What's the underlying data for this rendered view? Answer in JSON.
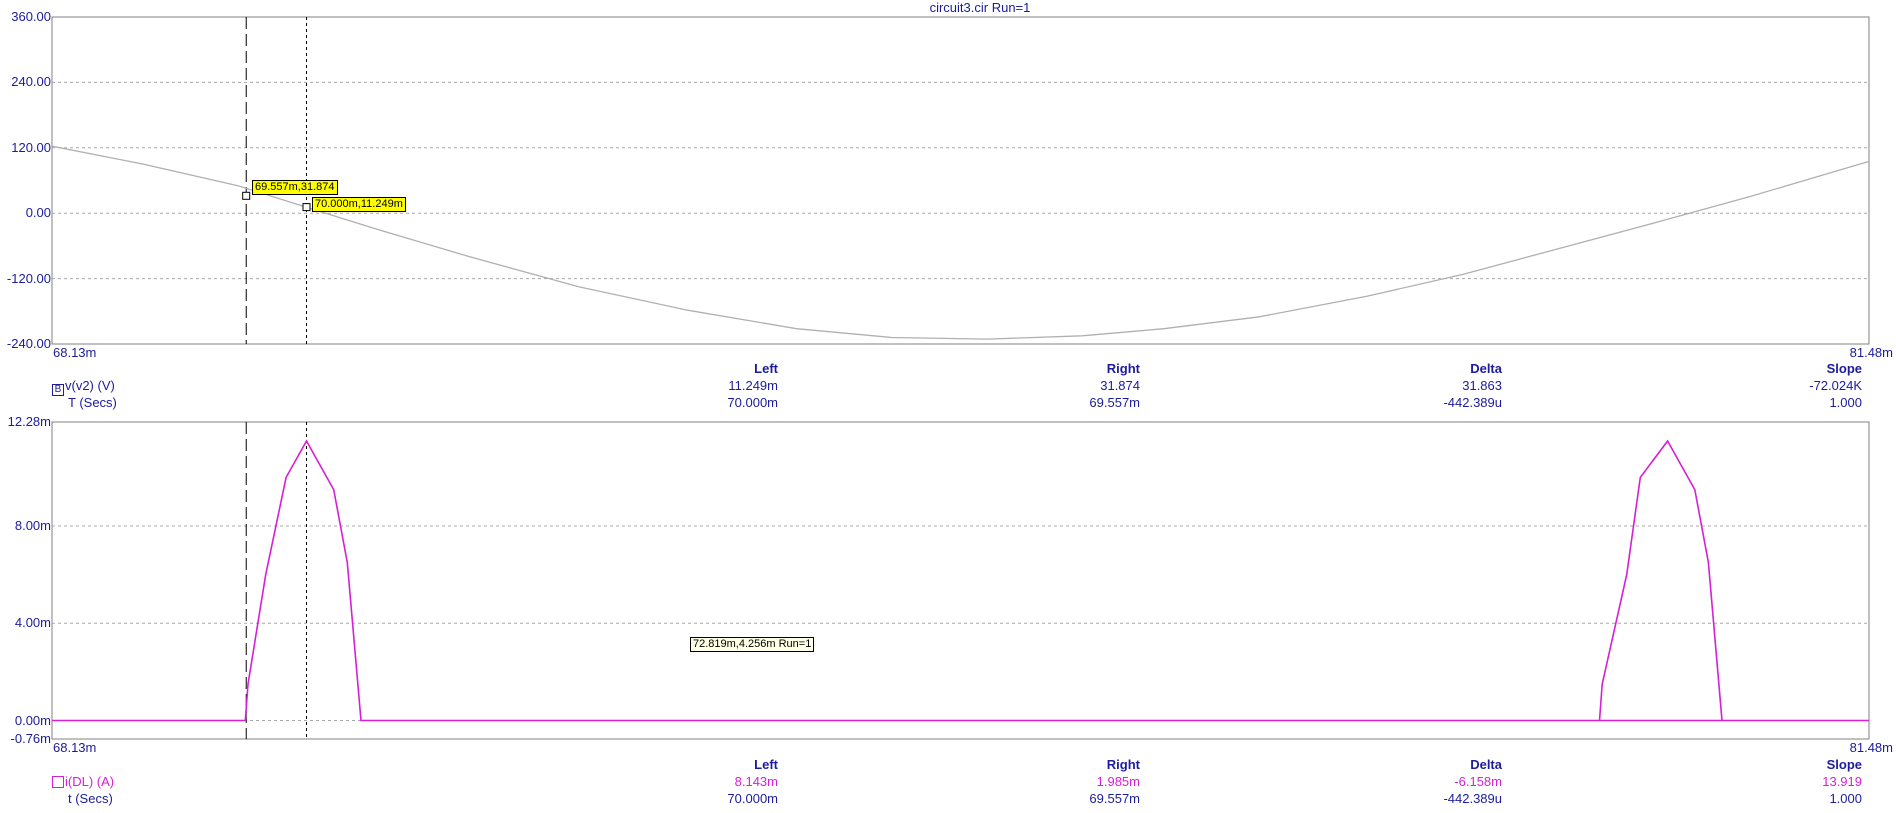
{
  "title": "circuit3.cir Run=1",
  "colors": {
    "axis_text": "#1c1c9c",
    "series_top": "#b0b0b0",
    "series_bottom": "#d61fd6",
    "grid": "#a8a8a8",
    "cursor_tag": "#ffff00"
  },
  "chart_data": [
    {
      "type": "line",
      "name": "top-panel",
      "y_tick_labels": [
        "360.00",
        "240.00",
        "120.00",
        "0.00",
        "-120.00",
        "-240.00"
      ],
      "y_ticks": [
        360,
        240,
        120,
        0,
        -120,
        -240
      ],
      "ylim": [
        -240,
        360
      ],
      "x_min_label": "68.13m",
      "x_max_label": "81.48m",
      "xlim": [
        68.13,
        81.48
      ],
      "x_unit": "ms",
      "series": [
        {
          "name": "v(v2) (V)",
          "x": [
            68.13,
            68.8,
            69.5,
            70.0,
            70.5,
            71.2,
            72.0,
            72.8,
            73.6,
            74.3,
            75.0,
            75.7,
            76.3,
            77.0,
            77.8,
            78.5,
            79.2,
            79.9,
            80.6,
            81.48
          ],
          "y": [
            123,
            90,
            50,
            11,
            -28,
            -80,
            -135,
            -178,
            -212,
            -228,
            -231,
            -225,
            -212,
            -190,
            -152,
            -112,
            -65,
            -18,
            30,
            95
          ]
        }
      ],
      "cursor_tags": [
        "69.557m,31.874",
        "70.000m,11.249m"
      ],
      "cursors": [
        {
          "x": 69.557,
          "y": 31.874,
          "style": "dashed"
        },
        {
          "x": 70.0,
          "y": 11.249,
          "style": "dotted"
        }
      ],
      "readout": {
        "headers": [
          "Left",
          "Right",
          "Delta",
          "Slope"
        ],
        "series_label": "v(v2) (V)",
        "series_icon": "B",
        "x_label": "T (Secs)",
        "series_values": [
          "11.249m",
          "31.874",
          "31.863",
          "-72.024K"
        ],
        "x_values": [
          "70.000m",
          "69.557m",
          "-442.389u",
          "1.000"
        ]
      }
    },
    {
      "type": "line",
      "name": "bottom-panel",
      "y_tick_labels": [
        "12.28m",
        "8.00m",
        "4.00m",
        "0.00m",
        "-0.76m"
      ],
      "y_ticks": [
        12.28,
        8.0,
        4.0,
        0.0,
        -0.76
      ],
      "ylim": [
        -0.76,
        12.28
      ],
      "x_min_label": "68.13m",
      "x_max_label": "81.48m",
      "xlim": [
        68.13,
        81.48
      ],
      "x_unit": "ms",
      "series": [
        {
          "name": "i(DL) (A)",
          "x": [
            68.13,
            69.55,
            69.57,
            69.7,
            69.85,
            70.0,
            70.2,
            70.3,
            70.4,
            81.48
          ],
          "y": [
            0,
            0,
            1.5,
            6.0,
            10.0,
            11.5,
            9.5,
            6.5,
            0,
            0
          ],
          "note_pulse2_x": [
            79.5,
            79.52,
            79.7,
            79.8,
            80.0,
            80.2,
            80.3,
            80.4
          ]
        }
      ],
      "pulse2": {
        "x": [
          79.5,
          79.52,
          79.7,
          79.8,
          80.0,
          80.2,
          80.3,
          80.4
        ],
        "y": [
          0,
          1.5,
          6.0,
          10.0,
          11.5,
          9.5,
          6.5,
          0
        ]
      },
      "hover_tag": "72.819m,4.256m Run=1",
      "readout": {
        "headers": [
          "Left",
          "Right",
          "Delta",
          "Slope"
        ],
        "series_label": "i(DL) (A)",
        "x_label": "t (Secs)",
        "series_values": [
          "8.143m",
          "1.985m",
          "-6.158m",
          "13.919"
        ],
        "x_values": [
          "70.000m",
          "69.557m",
          "-442.389u",
          "1.000"
        ]
      }
    }
  ]
}
